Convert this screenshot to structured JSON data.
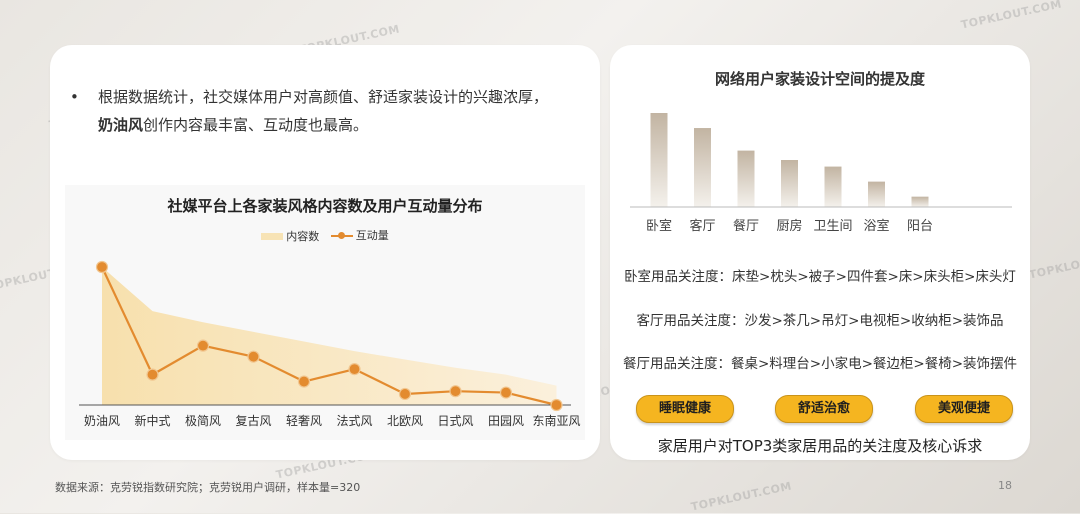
{
  "bullet": {
    "symbol": "•",
    "line_before": "根据数据统计，社交媒体用户对高颜值、舒适家装设计的兴趣浓厚，",
    "bold": "奶油风",
    "line_after": "创作内容最丰富、互动度也最高。"
  },
  "left_chart": {
    "title": "社媒平台上各家装风格内容数及用户互动量分布",
    "legend": [
      "内容数",
      "互动量"
    ]
  },
  "right_panel": {
    "bar_title": "网络用户家装设计空间的提及度",
    "focus_lines": [
      "卧室用品关注度：床垫>枕头>被子>四件套>床>床头柜>床头灯",
      "客厅用品关注度：沙发>茶几>吊灯>电视柜>收纳柜>装饰品",
      "餐厅用品关注度：餐桌>料理台>小家电>餐边柜>餐椅>装饰摆件"
    ],
    "pills": [
      "睡眠健康",
      "舒适治愈",
      "美观便捷"
    ],
    "caption": "家居用户对TOP3类家居用品的关注度及核心诉求"
  },
  "footer": {
    "source": "数据来源：克劳锐指数研究院；克劳锐用户调研，样本量=320",
    "page": "18"
  },
  "watermark": "TOPKLOUT.COM",
  "colors": {
    "area_fill": "#f7e3b5",
    "line": "#e38b2f",
    "bar_top": "#c2b4a2",
    "bar_bottom": "#f4f1ec",
    "pill": "#f5b520"
  },
  "chart_data": [
    {
      "type": "line",
      "title": "社媒平台上各家装风格内容数及用户互动量分布",
      "categories": [
        "奶油风",
        "新中式",
        "极简风",
        "复古风",
        "轻奢风",
        "法式风",
        "北欧风",
        "日式风",
        "田园风",
        "东南亚风"
      ],
      "series": [
        {
          "name": "内容数",
          "type": "area",
          "values": [
            100,
            68,
            60,
            53,
            46,
            39,
            33,
            27,
            22,
            14
          ]
        },
        {
          "name": "互动量",
          "type": "line",
          "values": [
            100,
            22,
            43,
            35,
            17,
            26,
            8,
            10,
            9,
            0
          ]
        }
      ],
      "ylim": [
        0,
        100
      ],
      "grid": false,
      "legend_position": "top-center"
    },
    {
      "type": "bar",
      "title": "网络用户家装设计空间的提及度",
      "categories": [
        "卧室",
        "客厅",
        "餐厅",
        "厨房",
        "卫生间",
        "浴室",
        "阳台"
      ],
      "values": [
        100,
        84,
        60,
        50,
        43,
        27,
        11
      ],
      "ylim": [
        0,
        100
      ],
      "grid": false
    }
  ]
}
